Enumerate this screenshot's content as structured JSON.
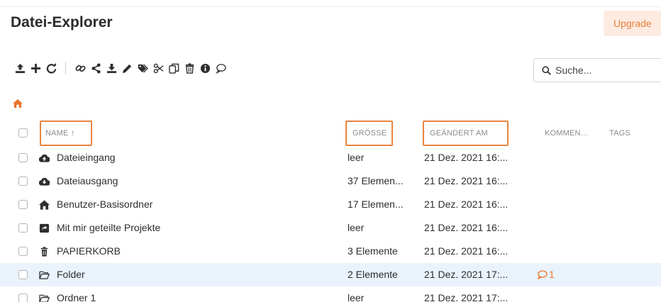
{
  "app": {
    "title": "Datei-Explorer",
    "upgrade_label": "Upgrade"
  },
  "toolbar": {
    "icons": [
      "upload-icon",
      "add-icon",
      "refresh-icon",
      "link-icon",
      "share-icon",
      "download-icon",
      "edit-icon",
      "tag-icon",
      "cut-icon",
      "copy-icon",
      "delete-icon",
      "info-icon",
      "comment-icon"
    ]
  },
  "search": {
    "placeholder": "Suche..."
  },
  "columns": {
    "name": "NAME ↑",
    "size": "GRÖSSE",
    "modified": "GEÄNDERT AM",
    "comments": "KOMMEN...",
    "tags": "TAGS"
  },
  "rows": [
    {
      "icon": "cloud-upload-icon",
      "name": "Dateieingang",
      "size": "leer",
      "modified": "21 Dez. 2021 16:...",
      "comments": ""
    },
    {
      "icon": "cloud-download-icon",
      "name": "Dateiausgang",
      "size": "37 Elemen...",
      "modified": "21 Dez. 2021 16:...",
      "comments": ""
    },
    {
      "icon": "home-icon",
      "name": "Benutzer-Basisordner",
      "size": "17 Elemen...",
      "modified": "21 Dez. 2021 16:...",
      "comments": ""
    },
    {
      "icon": "shared-projects-icon",
      "name": "Mit mir geteilte Projekte",
      "size": "leer",
      "modified": "21 Dez. 2021 16:...",
      "comments": ""
    },
    {
      "icon": "trash-icon",
      "name": "PAPIERKORB",
      "size": "3 Elemente",
      "modified": "21 Dez. 2021 16:...",
      "comments": ""
    },
    {
      "icon": "folder-open-icon",
      "name": "Folder",
      "size": "2 Elemente",
      "modified": "21 Dez. 2021 17:...",
      "comments": "1"
    },
    {
      "icon": "folder-open-icon",
      "name": "Ordner 1",
      "size": "leer",
      "modified": "21 Dez. 2021 17:...",
      "comments": ""
    }
  ],
  "colors": {
    "accent": "#e8762d",
    "highlight_border": "#e8853f",
    "selected_row": "#eaf2fb",
    "upgrade_bg": "#fdebe1"
  }
}
